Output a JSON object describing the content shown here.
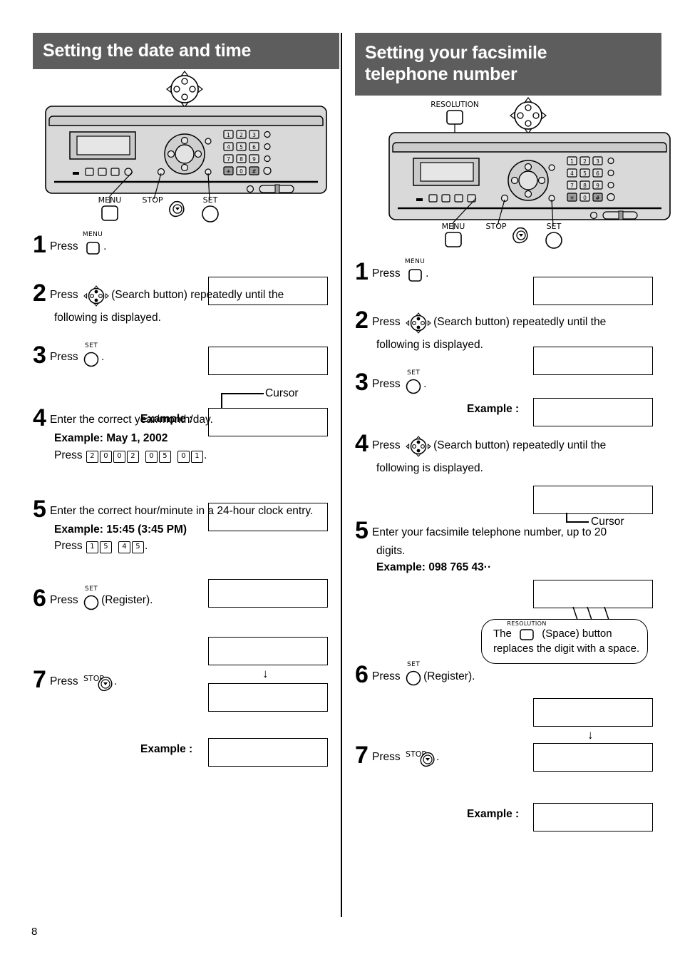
{
  "page": {
    "number": "8"
  },
  "left_column": {
    "heading": "Setting the date and time",
    "diagram": {
      "name": "fax-machine-control-panel",
      "callouts": [
        "MENU",
        "STOP",
        "SET"
      ],
      "navigator_label": "navigator-search-button"
    },
    "steps": [
      {
        "number": "1",
        "press_label": "Press",
        "button": "MENU",
        "period": ".",
        "lcd": ""
      },
      {
        "number": "2",
        "press_label": "Press",
        "button": "search-navigator",
        "text_after": "(Search button) repeatedly until the",
        "text_line2": "following is displayed.",
        "lcd": ""
      },
      {
        "number": "3",
        "press_label": "Press",
        "button": "SET",
        "period": ".",
        "cursor_label": "Cursor",
        "example_label": "Example :",
        "lcd": ""
      },
      {
        "number": "4",
        "text": "Enter the correct year/month/day.",
        "example": "Example: May 1, 2002",
        "press_label": "Press",
        "keys": [
          "2",
          "0",
          "0",
          "2",
          " ",
          "0",
          "5",
          " ",
          "0",
          "1"
        ],
        "period": ".",
        "lcd": ""
      },
      {
        "number": "5",
        "text": "Enter the correct hour/minute in a 24-hour clock entry.",
        "example": "Example: 15:45 (3:45 PM)",
        "press_label": "Press",
        "keys": [
          "1",
          "5",
          " ",
          "4",
          "5"
        ],
        "period": ".",
        "lcd": ""
      },
      {
        "number": "6",
        "press_label": "Press",
        "button": "SET",
        "text_after": "(Register).",
        "lcd": "",
        "arrow": "↓",
        "lcd2": ""
      },
      {
        "number": "7",
        "press_label": "Press",
        "button": "STOP",
        "period": ".",
        "example_label": "Example :",
        "lcd": ""
      }
    ]
  },
  "right_column": {
    "heading_line1": "Setting your facsimile",
    "heading_line2": "telephone number",
    "diagram": {
      "name": "fax-machine-control-panel",
      "callouts": [
        "RESOLUTION",
        "MENU",
        "STOP",
        "SET"
      ],
      "navigator_label": "navigator-search-button"
    },
    "steps": [
      {
        "number": "1",
        "press_label": "Press",
        "button": "MENU",
        "period": ".",
        "lcd": ""
      },
      {
        "number": "2",
        "press_label": "Press",
        "button": "search-navigator",
        "text_after": "(Search button) repeatedly until the",
        "text_line2": "following is displayed.",
        "lcd": ""
      },
      {
        "number": "3",
        "press_label": "Press",
        "button": "SET",
        "period": ".",
        "example_label": "Example :",
        "lcd": ""
      },
      {
        "number": "4",
        "press_label": "Press",
        "button": "search-navigator",
        "text_after": "(Search button) repeatedly until the",
        "text_line2": "following is displayed.",
        "cursor_label": "Cursor",
        "lcd": ""
      },
      {
        "number": "5",
        "text_line1": "Enter your facsimile telephone number, up to 20",
        "text_line2": "digits.",
        "example": "Example: 098 765 43··",
        "lcd": ""
      },
      {
        "number": "6",
        "press_label": "Press",
        "button": "SET",
        "text_after": "(Register).",
        "lcd": "",
        "arrow": "↓",
        "lcd2": ""
      },
      {
        "number": "7",
        "press_label": "Press",
        "button": "STOP",
        "period": ".",
        "example_label": "Example :",
        "lcd": ""
      }
    ],
    "note_balloon": {
      "text_before": "The",
      "button": "RESOLUTION",
      "text_after": "(Space) button",
      "line2": "replaces the digit with a space."
    }
  },
  "colors": {
    "banner_background": "#5d5d5d",
    "banner_text": "#ffffff",
    "ink": "#000000",
    "panel_body": "#d9d9d9",
    "panel_shade": "#bfbfbf"
  }
}
